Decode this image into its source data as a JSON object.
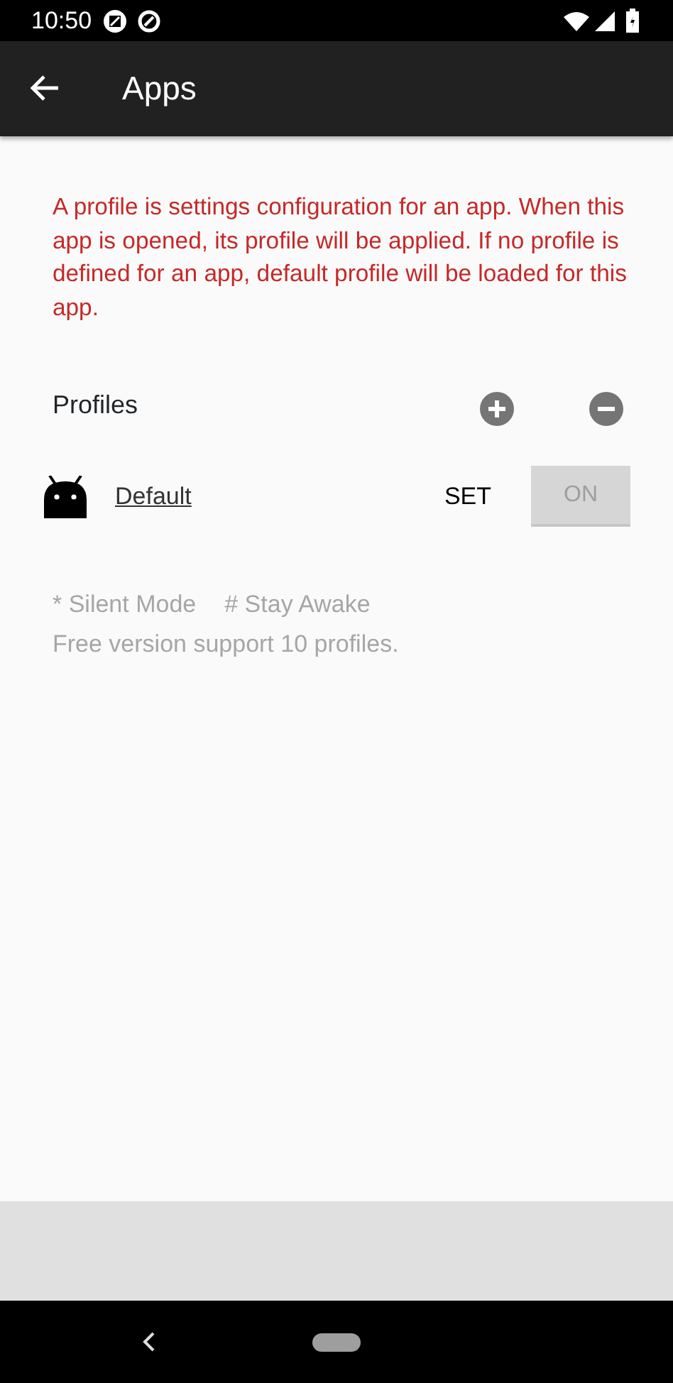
{
  "status_bar": {
    "time": "10:50"
  },
  "toolbar": {
    "title": "Apps"
  },
  "info": "A profile is settings configuration for an app. When this app is opened, its profile will be applied. If no profile is defined for an app, default profile will be loaded for this app.",
  "profiles": {
    "heading": "Profiles",
    "items": [
      {
        "name": "Default",
        "set_label": "SET",
        "toggle": {
          "label": "ON",
          "disabled": true
        }
      }
    ]
  },
  "legend": [
    "* Silent Mode",
    "# Stay Awake"
  ],
  "note": "Free version support 10 profiles."
}
